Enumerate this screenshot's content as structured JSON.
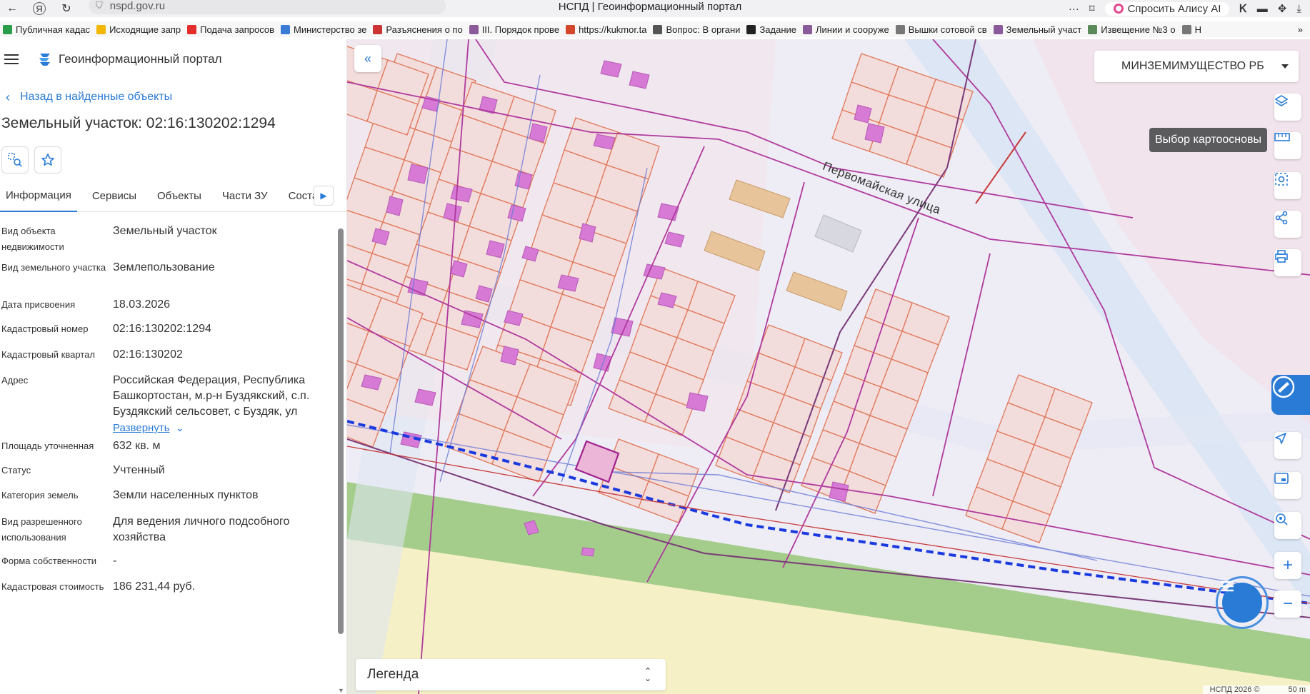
{
  "browser": {
    "url": "nspd.gov.ru",
    "tab_title": "НСПД | Геоинформационный портал",
    "alice_label": "Спросить Алису AI",
    "bookmarks": [
      {
        "label": "Публичная кадас",
        "color": "#2a9d4a"
      },
      {
        "label": "Исходящие запр",
        "color": "#f2b705"
      },
      {
        "label": "Подача запросов",
        "color": "#e32d2d"
      },
      {
        "label": "Министерство зе",
        "color": "#3a7bd5"
      },
      {
        "label": "Разъяснения о по",
        "color": "#c33"
      },
      {
        "label": "III. Порядок прове",
        "color": "#8a5a9a"
      },
      {
        "label": "https://kukmor.ta",
        "color": "#d4472d"
      },
      {
        "label": "Вопрос: В органи",
        "color": "#555"
      },
      {
        "label": "Задание",
        "color": "#222"
      },
      {
        "label": "Линии и сооруже",
        "color": "#8a5a9a"
      },
      {
        "label": "Вышки сотовой св",
        "color": "#777"
      },
      {
        "label": "Земельный участ",
        "color": "#8a5a9a"
      },
      {
        "label": "Извещение №3 о",
        "color": "#5a8a5a"
      },
      {
        "label": "Н",
        "color": "#777"
      }
    ],
    "more_bookmarks": "»"
  },
  "app": {
    "title": "Геоинформационный портал",
    "back_label": "Назад в найденные объекты",
    "object_title": "Земельный участок: 02:16:130202:1294",
    "tabs": [
      "Информация",
      "Сервисы",
      "Объекты",
      "Части ЗУ",
      "Состав"
    ],
    "active_tab": "Информация",
    "expand_label": "Развернуть",
    "properties": [
      {
        "label": "Вид объекта недвижимости",
        "value": "Земельный участок"
      },
      {
        "label": "Вид земельного участка",
        "value": "Землепользование"
      },
      {
        "label": "Дата присвоения",
        "value": "18.03.2026"
      },
      {
        "label": "Кадастровый номер",
        "value": "02:16:130202:1294"
      },
      {
        "label": "Кадастровый квартал",
        "value": "02:16:130202"
      },
      {
        "label": "Адрес",
        "value": "Российская Федерация, Республика Башкортостан, м.р-н Буздякский, с.п. Буздякский сельсовет, с Буздяк, ул"
      },
      {
        "label": "Площадь уточненная",
        "value": "632 кв. м"
      },
      {
        "label": "Статус",
        "value": "Учтенный"
      },
      {
        "label": "Категория земель",
        "value": "Земли населенных пунктов"
      },
      {
        "label": "Вид разрешенного использования",
        "value": "Для ведения личного подсобного хозяйства"
      },
      {
        "label": "Форма собственности",
        "value": "-"
      },
      {
        "label": "Кадастровая стоимость",
        "value": "186 231,44 руб."
      }
    ]
  },
  "map": {
    "org_select": "МИНЗЕМИМУЩЕСТВО РБ",
    "tooltip": "Выбор картоосновы",
    "street_label": "Первомайская улица",
    "legend_label": "Легенда",
    "footer_copyright": "НСПД 2026 ©",
    "footer_scale": "50 m",
    "tools": [
      "layers-icon",
      "ruler-icon",
      "select-area-icon",
      "share-icon",
      "print-icon",
      "locate-icon",
      "minimap-icon",
      "search-location-icon",
      "zoom-in-icon",
      "zoom-out-icon"
    ]
  },
  "colors": {
    "accent": "#2a7bd5",
    "parcel_fill": "#f3dcdc",
    "parcel_stroke": "#e0785a",
    "building": "#d67ad6",
    "boundary": "#b03a9e",
    "green": "#9fca84",
    "yellow": "#f6f0c6",
    "road": "#c8d8f0"
  }
}
